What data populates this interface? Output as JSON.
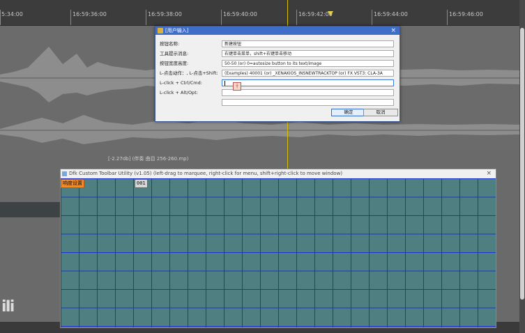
{
  "ruler": {
    "labels": [
      "5:34:00",
      "16:59:36:00",
      "16:59:38:00",
      "16:59:40:00",
      "16:59:42:00",
      "16:59:44:00",
      "16:59:46:00"
    ]
  },
  "media_item": {
    "label": "[-2.27db] (伴奏 曲目 256-260.mp)"
  },
  "daw_logo": "iIi",
  "dialog": {
    "title": "[用户输入]",
    "close_glyph": "×",
    "fields": [
      {
        "label": "按钮名称:",
        "value": "新建按钮"
      },
      {
        "label": "工具提示消息:",
        "value": "右键单击菜单，shift+右键单击移动"
      },
      {
        "label": "按钮宽度高度:",
        "value": "50-50 (or) 0=autosize button to its text/image"
      },
      {
        "label": "L-点击动作：, L-点击+Shift:",
        "value": "(Examples) 40001 (or) _XENAKIOS_INSNEWTRACKTOP (or) FX VST3: CLA-3A"
      },
      {
        "label": "L-click + Ctrl/Cmd:",
        "value": ""
      },
      {
        "label": "L-click + Alt/Opt:",
        "value": ""
      },
      {
        "label": "",
        "value": ""
      }
    ],
    "ok_label": "确定",
    "cancel_label": "取消"
  },
  "toolbar_window": {
    "title": "Dfk Custom Toolbar Utility (v1.05) (left-drag to marquee, right-click for menu, shift+right-click to move window)",
    "close_glyph": "×",
    "button_1": "响度设置",
    "button_2": "001"
  },
  "colors": {
    "accent_titlebar": "#3f6ec9",
    "grid_cell": "#4f7f80",
    "grid_line": "#1f35c8",
    "toolbar_button": "#f08a2a",
    "cursor": "#d6c200"
  }
}
